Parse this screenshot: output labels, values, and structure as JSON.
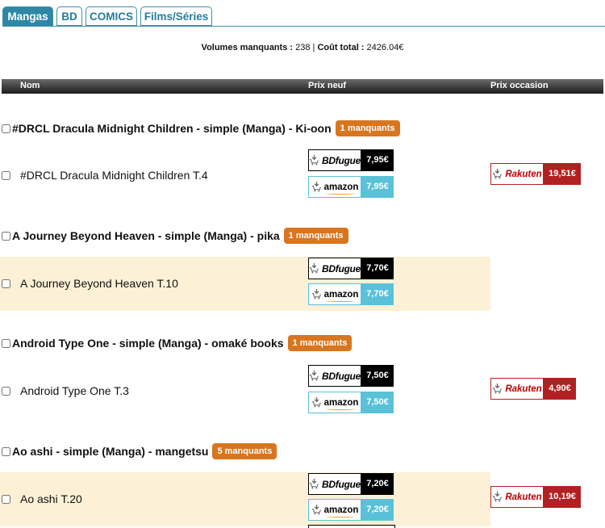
{
  "tabs": [
    {
      "label": "Mangas"
    },
    {
      "label": "BD"
    },
    {
      "label": "COMICS"
    },
    {
      "label": "Films/Séries"
    }
  ],
  "summary": {
    "missing_label": "Volumes manquants :",
    "missing_value": "238",
    "separator": "|",
    "cost_label": "Coût total :",
    "cost_value": "2426.04€"
  },
  "table_header": {
    "name": "Nom",
    "new_price": "Prix neuf",
    "used_price": "Prix occasion"
  },
  "stores": {
    "bdfugue": "BDfugue",
    "amazon": "amazon",
    "rakuten": "Rakuten"
  },
  "groups": [
    {
      "title": "#DRCL Dracula Midnight Children - simple (Manga) - Ki-oon",
      "badge": "1 manquants",
      "volume": "#DRCL Dracula Midnight Children T.4",
      "bdfugue": "7,95€",
      "amazon": "7,95€",
      "rakuten": "19,51€"
    },
    {
      "title": "A Journey Beyond Heaven - simple (Manga) - pika",
      "badge": "1 manquants",
      "volume": "A Journey Beyond Heaven T.10",
      "bdfugue": "7,70€",
      "amazon": "7,70€",
      "rakuten": ""
    },
    {
      "title": "Android Type One - simple (Manga) - omaké books",
      "badge": "1 manquants",
      "volume": "Android Type One T.3",
      "bdfugue": "7,50€",
      "amazon": "7,50€",
      "rakuten": "4,90€"
    },
    {
      "title": "Ao ashi - simple (Manga) - mangetsu",
      "badge": "5 manquants",
      "volume": "Ao ashi T.20",
      "bdfugue": "7,20€",
      "amazon": "7,20€",
      "rakuten": "10,19€"
    }
  ]
}
